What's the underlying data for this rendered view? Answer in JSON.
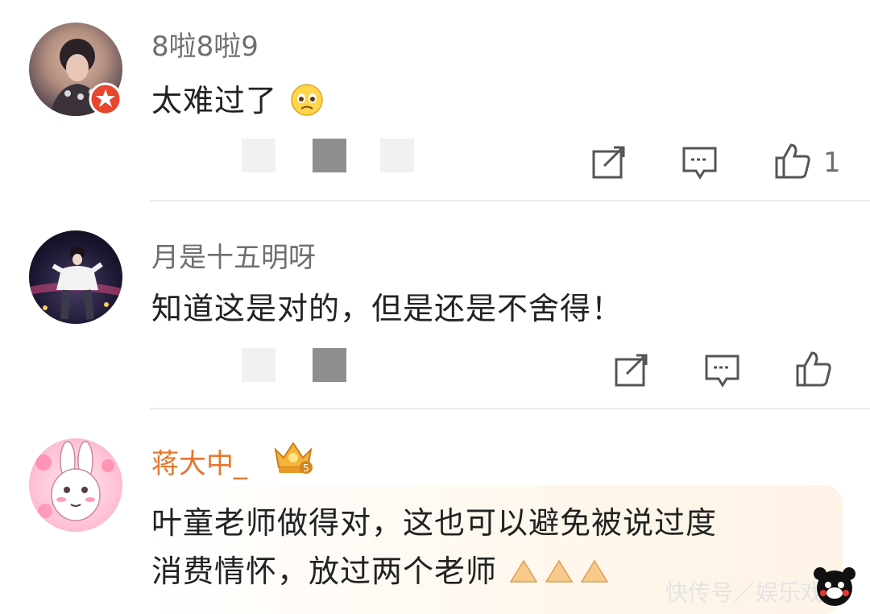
{
  "comments": [
    {
      "username": "8啦8啦9",
      "text": "太难过了",
      "like_count": "1",
      "emoji": "sad-face-emoji"
    },
    {
      "username": "月是十五明呀",
      "text": "知道这是对的，但是还是不舍得！",
      "like_count": ""
    },
    {
      "username": "蒋大中_",
      "text_line1": "叶童老师做得对，这也可以避免被说过度",
      "text_line2": "消费情怀，放过两个老师",
      "emoji": "pray-hands-emoji"
    }
  ],
  "watermark": "快传号／娱乐戏",
  "colors": {
    "username": "#6f6f6f",
    "vip_username": "#e8752d",
    "text": "#222222",
    "icon": "#555555"
  }
}
